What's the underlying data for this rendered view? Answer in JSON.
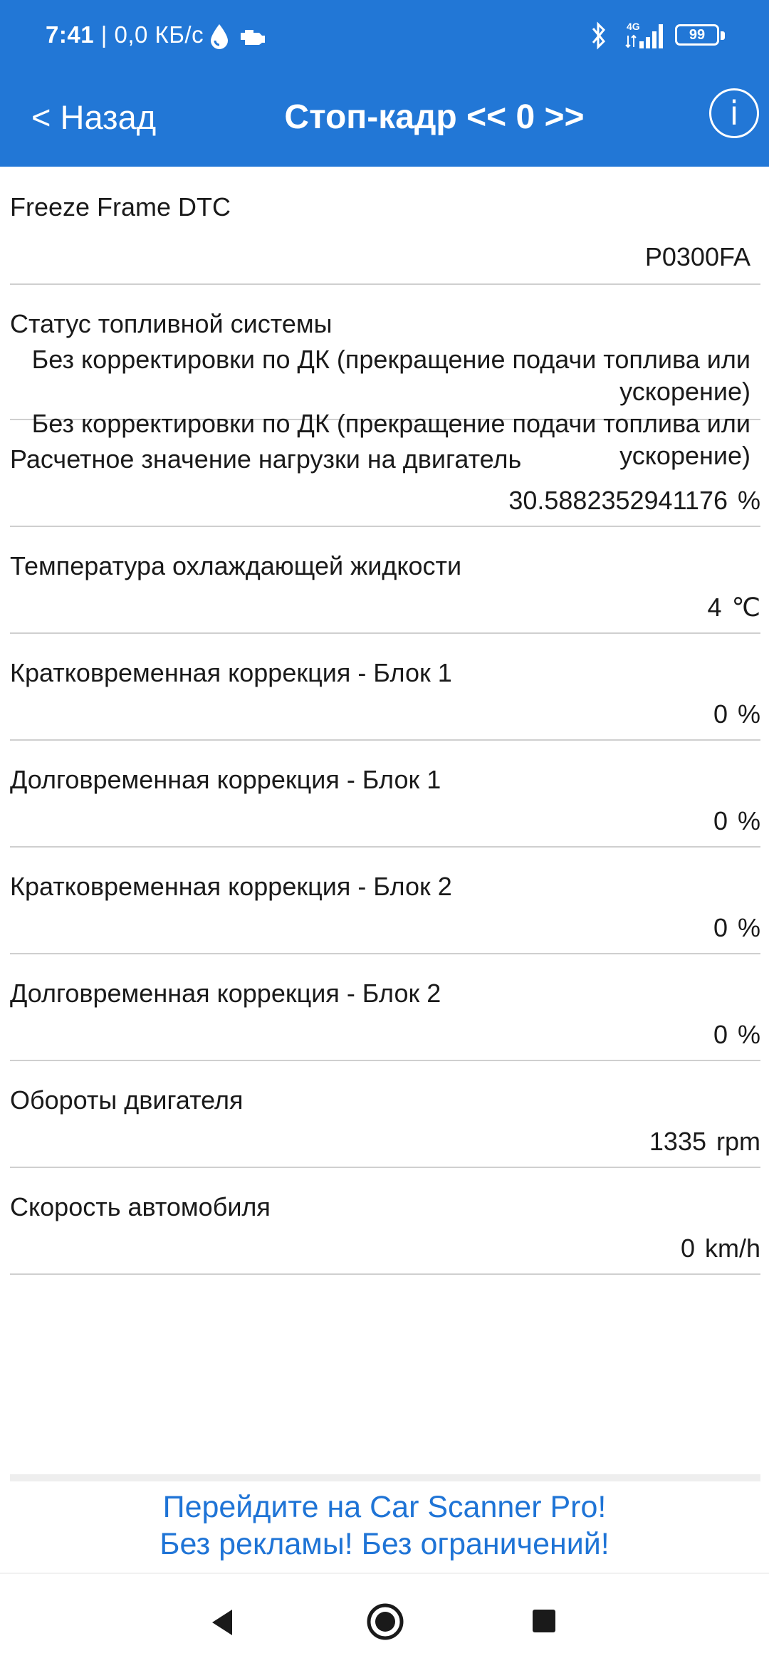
{
  "status_bar": {
    "time": "7:41",
    "network_speed": "| 0,0 КБ/с",
    "network_label": "4G",
    "battery_level": "99",
    "icons": [
      "water-drop-icon",
      "engine-icon",
      "bluetooth-icon",
      "signal-4g-icon",
      "battery-icon"
    ]
  },
  "toolbar": {
    "back_label": "< Назад",
    "title": "Стоп-кадр << 0 >>",
    "info_icon": "info-circle-icon",
    "background_color": "#2277d6"
  },
  "rows": [
    {
      "label": "Freeze Frame DTC",
      "value": "P0300FA",
      "unit": ""
    },
    {
      "label": "Статус топливной системы",
      "value": "Без корректировки по ДК (прекращение подачи топлива или ускорение)\nБез корректировки по ДК (прекращение подачи топлива или ускорение)",
      "unit": ""
    },
    {
      "label": "Расчетное значение нагрузки на двигатель",
      "value": "30.5882352941176",
      "unit": "%"
    },
    {
      "label": "Температура охлаждающей жидкости",
      "value": "4",
      "unit": "℃"
    },
    {
      "label": "Кратковременная коррекция - Блок 1",
      "value": "0",
      "unit": "%"
    },
    {
      "label": "Долговременная коррекция - Блок 1",
      "value": "0",
      "unit": "%"
    },
    {
      "label": "Кратковременная коррекция - Блок 2",
      "value": "0",
      "unit": "%"
    },
    {
      "label": "Долговременная коррекция - Блок 2",
      "value": "0",
      "unit": "%"
    },
    {
      "label": "Обороты двигателя",
      "value": "1335",
      "unit": "rpm"
    },
    {
      "label": "Скорость автомобиля",
      "value": "0",
      "unit": "km/h"
    }
  ],
  "promo": {
    "line1": "Перейдите на Car Scanner Pro!",
    "line2": "Без рекламы! Без ограничений!",
    "color": "#1f74d6"
  },
  "nav_bar": {
    "icons": [
      "nav-back-icon",
      "nav-home-icon",
      "nav-recents-icon"
    ]
  }
}
